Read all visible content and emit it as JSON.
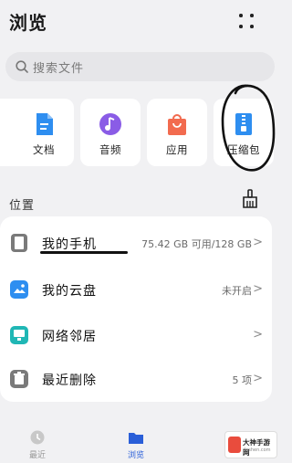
{
  "header": {
    "title": "浏览"
  },
  "search": {
    "placeholder": "搜索文件"
  },
  "categories": [
    {
      "label": "",
      "icon": "partial-category-icon"
    },
    {
      "label": "文档",
      "icon": "document-icon",
      "color": "#2e8ef0"
    },
    {
      "label": "音频",
      "icon": "music-icon",
      "color": "#8a5ce6"
    },
    {
      "label": "应用",
      "icon": "shopping-bag-icon",
      "color": "#f26b4f"
    },
    {
      "label": "压缩包",
      "icon": "zip-archive-icon",
      "color": "#2e8ef0"
    }
  ],
  "locations": {
    "title": "位置",
    "items": [
      {
        "label": "我的手机",
        "value": "75.42 GB 可用/128 GB",
        "icon": "phone-icon",
        "color": "#7a7a7a"
      },
      {
        "label": "我的云盘",
        "value": "未开启",
        "icon": "cloud-drive-icon",
        "color": "#2e8ef0"
      },
      {
        "label": "网络邻居",
        "value": "",
        "icon": "network-neighbor-icon",
        "color": "#20b7b5"
      },
      {
        "label": "最近删除",
        "value": "5 项",
        "icon": "trash-icon",
        "color": "#7a7a7a"
      }
    ],
    "chevron": ">"
  },
  "bottom_nav": {
    "items": [
      {
        "label": "最近",
        "icon": "clock-icon",
        "active": false
      },
      {
        "label": "浏览",
        "icon": "folder-icon",
        "active": true
      }
    ]
  },
  "watermark": {
    "line1": "大神手游网",
    "line2": "dashen.com"
  },
  "colors": {
    "accent": "#2a5fd8",
    "background": "#f1f1f3"
  }
}
